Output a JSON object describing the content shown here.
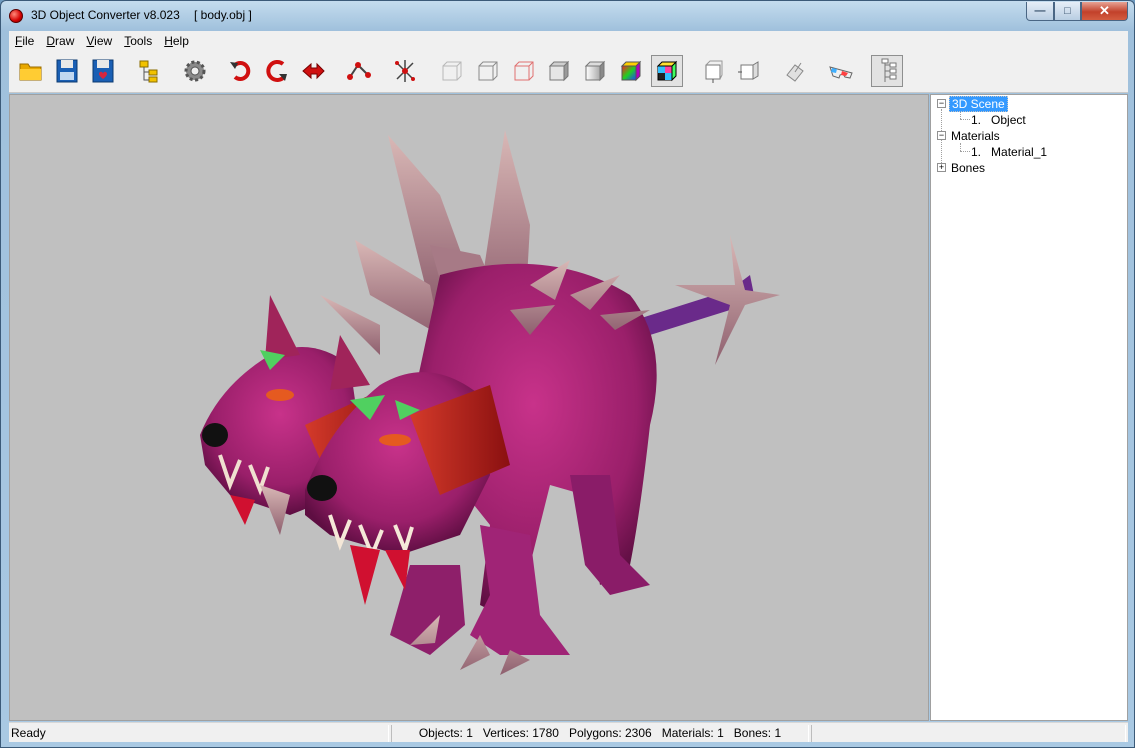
{
  "window": {
    "app_title": "3D Object Converter v8.023",
    "file_title": "[ body.obj ]",
    "minimize_glyph": "—",
    "maximize_glyph": "□",
    "close_glyph": "✕"
  },
  "menu": {
    "items": [
      {
        "accel": "F",
        "rest": "ile"
      },
      {
        "accel": "D",
        "rest": "raw"
      },
      {
        "accel": "V",
        "rest": "iew"
      },
      {
        "accel": "T",
        "rest": "ools"
      },
      {
        "accel": "H",
        "rest": "elp"
      }
    ]
  },
  "toolbar": {
    "buttons": [
      {
        "icon": "open-folder-icon"
      },
      {
        "icon": "save-icon"
      },
      {
        "icon": "save-as-icon"
      },
      {
        "icon": "hierarchy-icon"
      },
      {
        "icon": "settings-gear-icon"
      },
      {
        "icon": "rotate-icon"
      },
      {
        "icon": "orbit-icon"
      },
      {
        "icon": "move-icon"
      },
      {
        "icon": "vertex-edge-icon"
      },
      {
        "icon": "pivot-icon"
      },
      {
        "icon": "wireframe-icon"
      },
      {
        "icon": "wireframe-hidden-icon"
      },
      {
        "icon": "wireframe-red-icon"
      },
      {
        "icon": "flat-shading-icon"
      },
      {
        "icon": "smooth-shading-icon"
      },
      {
        "icon": "color-shading-icon"
      },
      {
        "icon": "texture-icon"
      },
      {
        "icon": "front-view-icon"
      },
      {
        "icon": "side-view-icon"
      },
      {
        "icon": "normals-icon"
      },
      {
        "icon": "stereo-glasses-icon"
      },
      {
        "icon": "scene-tree-icon"
      }
    ]
  },
  "tree": {
    "scene_label": "3D Scene",
    "scene_children": [
      {
        "num": "1.",
        "label": "Object"
      }
    ],
    "materials_label": "Materials",
    "materials_children": [
      {
        "num": "1.",
        "label": "Material_1"
      }
    ],
    "bones_label": "Bones",
    "collapse_glyph": "−",
    "expand_glyph": "+"
  },
  "status": {
    "ready": "Ready",
    "objects": "Objects: 1",
    "vertices": "Vertices: 1780",
    "polygons": "Polygons: 2306",
    "materials": "Materials: 1",
    "bones": "Bones: 1"
  },
  "colors": {
    "viewport_bg": "#c0c0c0",
    "model_body": "#b0256e",
    "model_dark": "#6a1250",
    "model_spikes": "#c9a2a6",
    "selection": "#3399ff"
  }
}
